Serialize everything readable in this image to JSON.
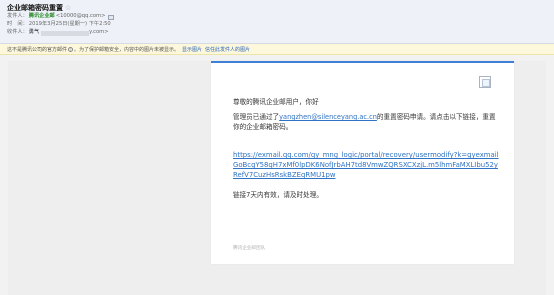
{
  "header": {
    "subject": "企业邮箱密码重置",
    "star_icon": "star-outline-icon",
    "from_label": "发件人：",
    "from_name": "腾讯企业邮",
    "from_address": "<10000@qq.com>",
    "contact_icon": "contact-card-icon",
    "time_label": "时　间：",
    "time_value": "2019年3月25日(星期一) 下午2:50",
    "to_label": "收件人：",
    "to_name": "勇气",
    "to_domain": "y.com>"
  },
  "warning": {
    "text": "这不是腾讯公司的官方邮件",
    "help_icon": "?",
    "text2": "。为了保护邮箱安全，内容中的图片未被显示。",
    "show_images": "显示图片",
    "trust_sender": "信任此发件人的图片"
  },
  "body": {
    "logo_icon": "broken-image-icon",
    "greeting": "尊敬的腾讯企业邮用户，你好",
    "intro_pre": "管理员已通过了",
    "admin_email": "yangzhen@silenceyang.ac.cn",
    "intro_post": "的重置密码申请。请点击以下链接，重置你的企业邮箱密码。",
    "reset_url": "https://exmail.qq.com/qy_mng_logic/portal/recovery/usermodify?k=gyexmailGoBcgY58qH7xMf0lpDK6NofJrbAH7td8VmwZQRSXCXzjL.m5lhmFaMXLIbu52yRefV7CuzHsRskBZEqRMU1pw",
    "validity": "链接7天内有效，请及时处理。",
    "signature": "腾讯企业邮团队"
  },
  "colors": {
    "accent": "#3f7fd6",
    "link": "#2e73c4",
    "sender_green": "#2a8a2a",
    "warning_bg": "#fdf8dc"
  }
}
